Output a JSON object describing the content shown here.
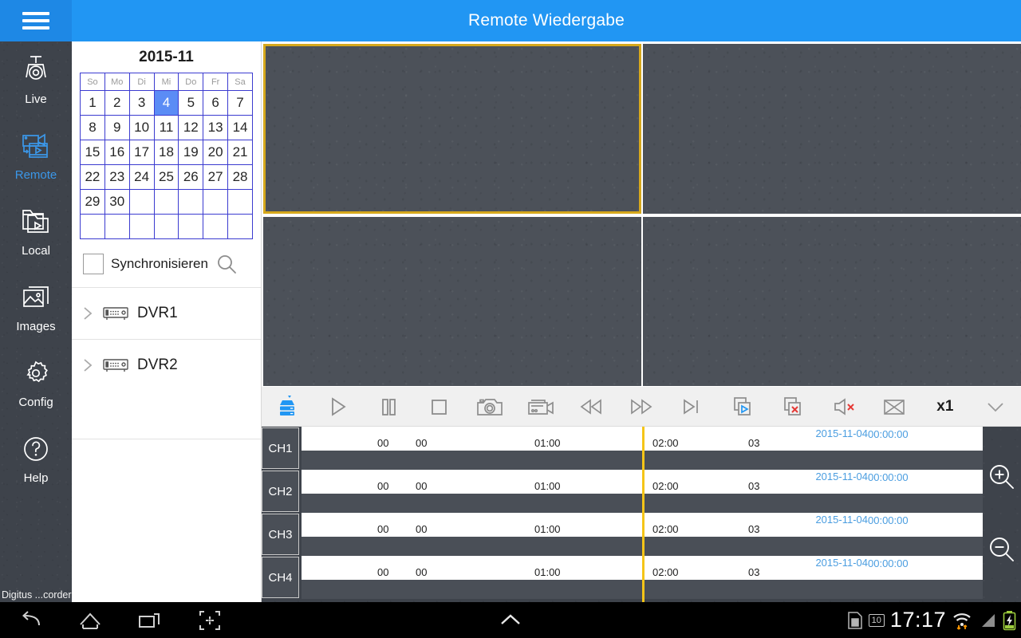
{
  "header": {
    "title": "Remote Wiedergabe",
    "menu_icon": "hamburger-icon",
    "accent_color": "#2196f3"
  },
  "sidebar": {
    "app_label": "Digitus ...corder",
    "items": [
      {
        "label": "Live",
        "icon": "camera-dome-icon",
        "active": false
      },
      {
        "label": "Remote",
        "icon": "remote-playback-icon",
        "active": true
      },
      {
        "label": "Local",
        "icon": "local-playback-icon",
        "active": false
      },
      {
        "label": "Images",
        "icon": "image-icon",
        "active": false
      },
      {
        "label": "Config",
        "icon": "gear-icon",
        "active": false
      },
      {
        "label": "Help",
        "icon": "question-icon",
        "active": false
      }
    ],
    "active_color": "#3b97e8"
  },
  "calendar": {
    "month_title": "2015-11",
    "weekdays": [
      "So",
      "Mo",
      "Di",
      "Mi",
      "Do",
      "Fr",
      "Sa"
    ],
    "weeks": [
      [
        "1",
        "2",
        "3",
        "4",
        "5",
        "6",
        "7"
      ],
      [
        "8",
        "9",
        "10",
        "11",
        "12",
        "13",
        "14"
      ],
      [
        "15",
        "16",
        "17",
        "18",
        "19",
        "20",
        "21"
      ],
      [
        "22",
        "23",
        "24",
        "25",
        "26",
        "27",
        "28"
      ],
      [
        "29",
        "30",
        "",
        "",
        "",
        "",
        ""
      ],
      [
        "",
        "",
        "",
        "",
        "",
        "",
        ""
      ]
    ],
    "selected_day": "4",
    "selected_color": "#5b8cf5",
    "border_color": "#3b3bd0"
  },
  "sync": {
    "label": "Synchronisieren",
    "checked": false,
    "search_icon": "search-icon"
  },
  "devices": [
    {
      "name": "DVR1",
      "icon": "dvr-icon",
      "expand_icon": "chevron-right-icon"
    },
    {
      "name": "DVR2",
      "icon": "dvr-icon",
      "expand_icon": "chevron-right-icon"
    }
  ],
  "video_grid": {
    "panes": [
      {
        "id": "v1",
        "selected": true
      },
      {
        "id": "v2",
        "selected": false
      },
      {
        "id": "v3",
        "selected": false
      },
      {
        "id": "v4",
        "selected": false
      }
    ],
    "selection_color": "#d6a81c"
  },
  "toolbar": {
    "buttons": [
      {
        "name": "device-stack-button",
        "icon": "server-stack-icon",
        "label": "",
        "accent": "#2196f3"
      },
      {
        "name": "play-button",
        "icon": "play-icon",
        "label": ""
      },
      {
        "name": "pause-button",
        "icon": "pause-icon",
        "label": ""
      },
      {
        "name": "stop-button",
        "icon": "stop-icon",
        "label": ""
      },
      {
        "name": "snapshot-button",
        "icon": "camera-icon",
        "label": ""
      },
      {
        "name": "record-button",
        "icon": "video-camera-icon",
        "label": ""
      },
      {
        "name": "rewind-button",
        "icon": "rewind-icon",
        "label": ""
      },
      {
        "name": "fast-forward-button",
        "icon": "fast-forward-icon",
        "label": ""
      },
      {
        "name": "next-frame-button",
        "icon": "next-frame-icon",
        "label": ""
      },
      {
        "name": "play-all-button",
        "icon": "play-all-icon",
        "label": ""
      },
      {
        "name": "close-all-button",
        "icon": "close-all-icon",
        "label": ""
      },
      {
        "name": "mute-button",
        "icon": "speaker-mute-icon",
        "label": ""
      },
      {
        "name": "fullscreen-button",
        "icon": "fullscreen-icon",
        "label": ""
      },
      {
        "name": "speed-button",
        "icon": "",
        "label": "x1"
      },
      {
        "name": "collapse-button",
        "icon": "chevron-down-icon",
        "label": ""
      }
    ]
  },
  "timeline": {
    "channels": [
      "CH1",
      "CH2",
      "CH3",
      "CH4"
    ],
    "date_label": "2015-11-04",
    "time_label": "00:00:00",
    "ticks": [
      "00",
      "00",
      "01:00",
      "02:00",
      "03"
    ],
    "playhead_color": "#f5c518",
    "date_color": "#4a9de0",
    "zoom_in_icon": "zoom-in-icon",
    "zoom_out_icon": "zoom-out-icon"
  },
  "navbar": {
    "buttons": [
      {
        "name": "back-button",
        "icon": "back-arrow-icon"
      },
      {
        "name": "home-button",
        "icon": "home-icon"
      },
      {
        "name": "recents-button",
        "icon": "recents-icon"
      },
      {
        "name": "screenshot-button",
        "icon": "screenshot-icon"
      },
      {
        "name": "expand-button",
        "icon": "chevron-up-icon"
      }
    ],
    "status": {
      "sim_icon": "sim-card-icon",
      "notification_count": "10",
      "clock": "17:17",
      "wifi_icon": "wifi-icon",
      "signal_icon": "signal-icon",
      "battery_icon": "battery-charging-icon"
    }
  }
}
